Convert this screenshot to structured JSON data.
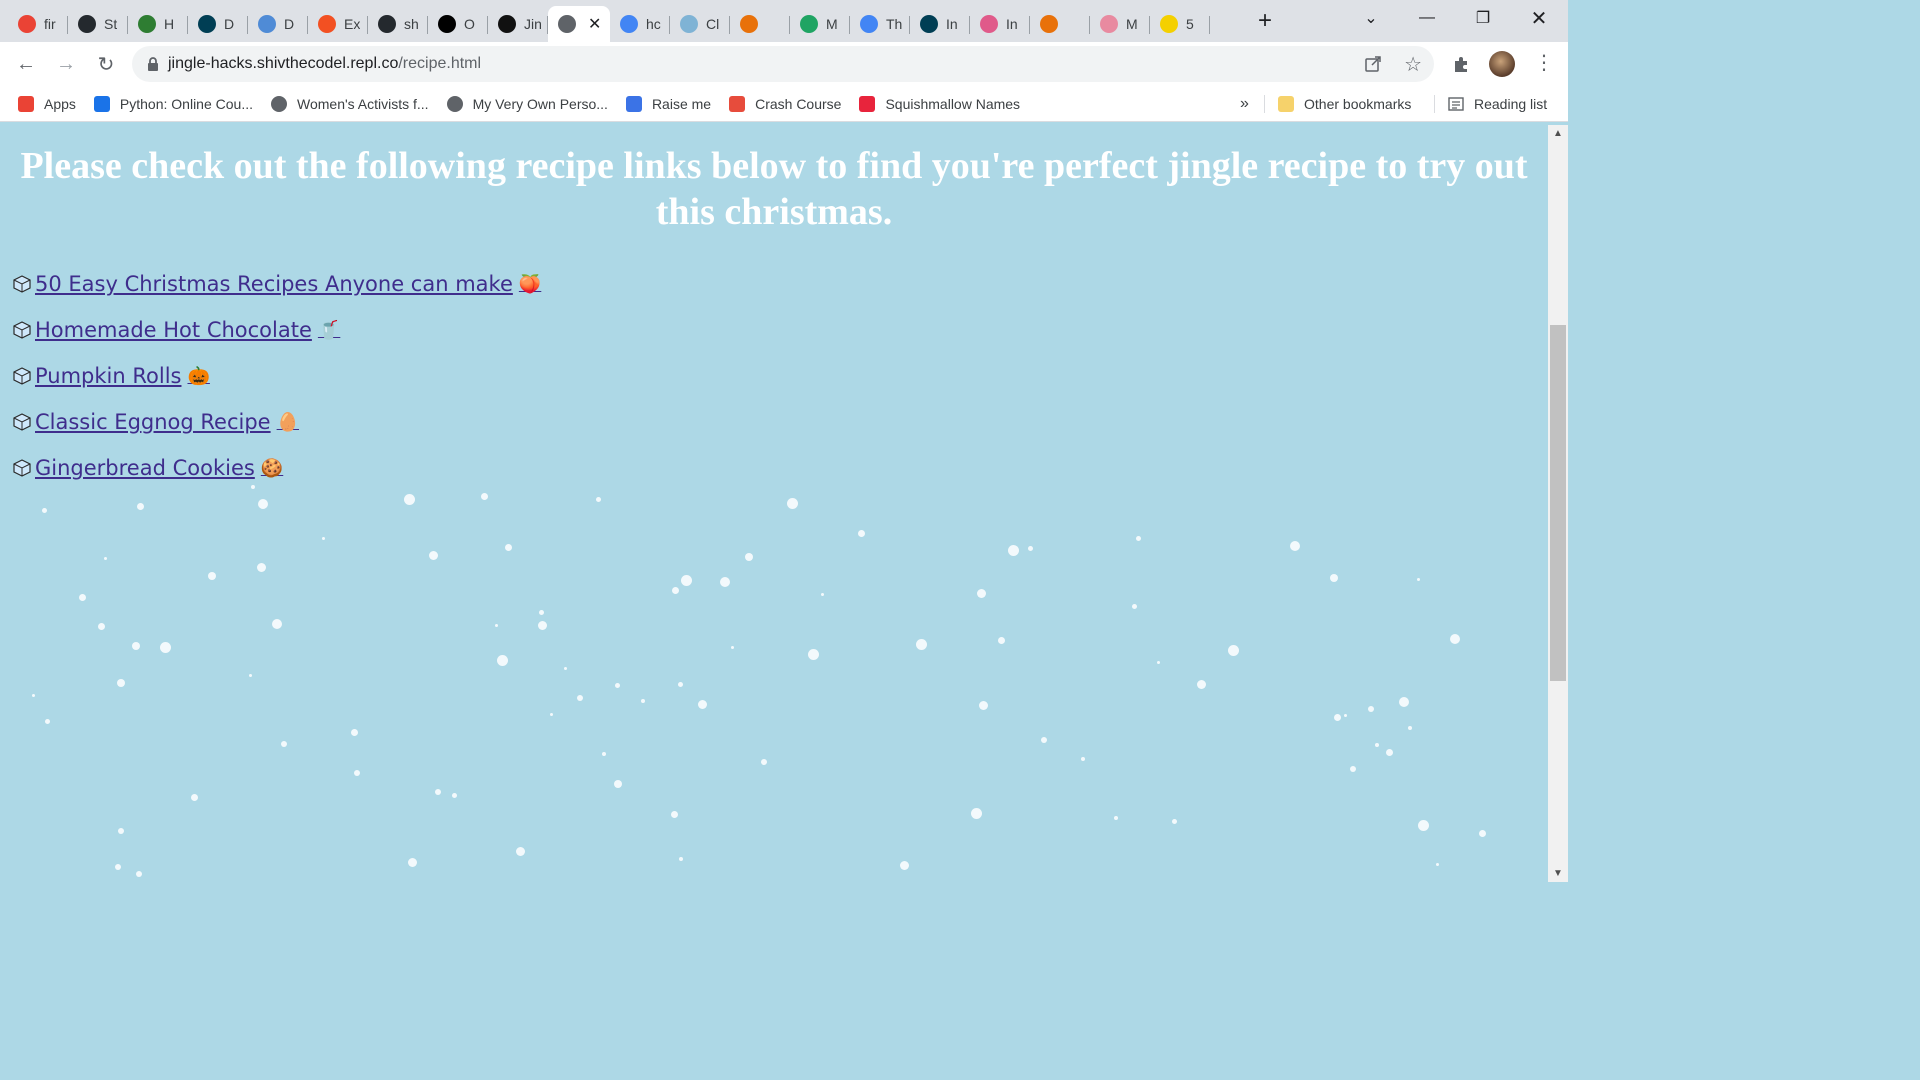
{
  "browser": {
    "tabs": [
      {
        "title": "fir",
        "icon": "google-icon",
        "color": "#ea4335"
      },
      {
        "title": "St",
        "icon": "github-icon",
        "color": "#24292e"
      },
      {
        "title": "H",
        "icon": "code-icon",
        "color": "#2e7d32"
      },
      {
        "title": "D",
        "icon": "devpost-icon",
        "color": "#003e54"
      },
      {
        "title": "D",
        "icon": "docs-icon",
        "color": "#4f8bd6"
      },
      {
        "title": "Ex",
        "icon": "microsoft-icon",
        "color": "#f25022"
      },
      {
        "title": "sh",
        "icon": "github-icon",
        "color": "#24292e"
      },
      {
        "title": "O",
        "icon": "sparkle-icon",
        "color": "#000000"
      },
      {
        "title": "Jin",
        "icon": "replit-icon",
        "color": "#111111"
      },
      {
        "title": "",
        "icon": "globe-icon",
        "color": "#5f6368",
        "active": true
      },
      {
        "title": "hc",
        "icon": "google-icon",
        "color": "#4285f4"
      },
      {
        "title": "Cl",
        "icon": "image-icon",
        "color": "#7fb3d5"
      },
      {
        "title": "",
        "icon": "shield-icon",
        "color": "#e8710a"
      },
      {
        "title": "M",
        "icon": "drive-icon",
        "color": "#1fa463"
      },
      {
        "title": "Th",
        "icon": "docs-icon",
        "color": "#4285f4"
      },
      {
        "title": "In",
        "icon": "devpost-icon",
        "color": "#003e54"
      },
      {
        "title": "In",
        "icon": "flower-icon",
        "color": "#e05a8a"
      },
      {
        "title": "",
        "icon": "shield-icon",
        "color": "#e8710a"
      },
      {
        "title": "M",
        "icon": "bird-icon",
        "color": "#e88aa0"
      },
      {
        "title": "5",
        "icon": "letter-e-icon",
        "color": "#f4d000"
      }
    ],
    "address": {
      "host": "jingle-hacks.shivthecodel.repl.co",
      "path": "/recipe.html"
    },
    "bookmarks": [
      {
        "label": "Apps",
        "icon": "apps-grid-icon",
        "color": "#ea4335"
      },
      {
        "label": "Python: Online Cou...",
        "icon": "video-icon",
        "color": "#1a73e8"
      },
      {
        "label": "Women's Activists f...",
        "icon": "globe-icon",
        "color": "#5f6368"
      },
      {
        "label": "My Very Own Perso...",
        "icon": "globe-icon",
        "color": "#5f6368"
      },
      {
        "label": "Raise me",
        "icon": "raise-icon",
        "color": "#3b73e6"
      },
      {
        "label": "Crash Course",
        "icon": "crash-course-icon",
        "color": "#e74c3c"
      },
      {
        "label": "Squishmallow Names",
        "icon": "fire-icon",
        "color": "#e8243c"
      }
    ],
    "overflow_label": "»",
    "other_bookmarks": "Other bookmarks",
    "reading_list": "Reading list"
  },
  "page": {
    "heading": "Please check out the following recipe links below to find you're perfect jingle recipe to try out this christmas.",
    "links": [
      {
        "text": "50 Easy Christmas Recipes Anyone can make",
        "emoji": "🍑"
      },
      {
        "text": "Homemade Hot Chocolate",
        "emoji": "🥤"
      },
      {
        "text": "Pumpkin Rolls",
        "emoji": "🎃"
      },
      {
        "text": "Classic Eggnog Recipe",
        "emoji": "🥚"
      },
      {
        "text": "Gingerbread Cookies",
        "emoji": "🍪"
      }
    ],
    "bullet_icon": "ice-cube-icon",
    "colors": {
      "background": "#add8e6",
      "heading": "#ffffff",
      "link": "#3f2d8c"
    }
  }
}
